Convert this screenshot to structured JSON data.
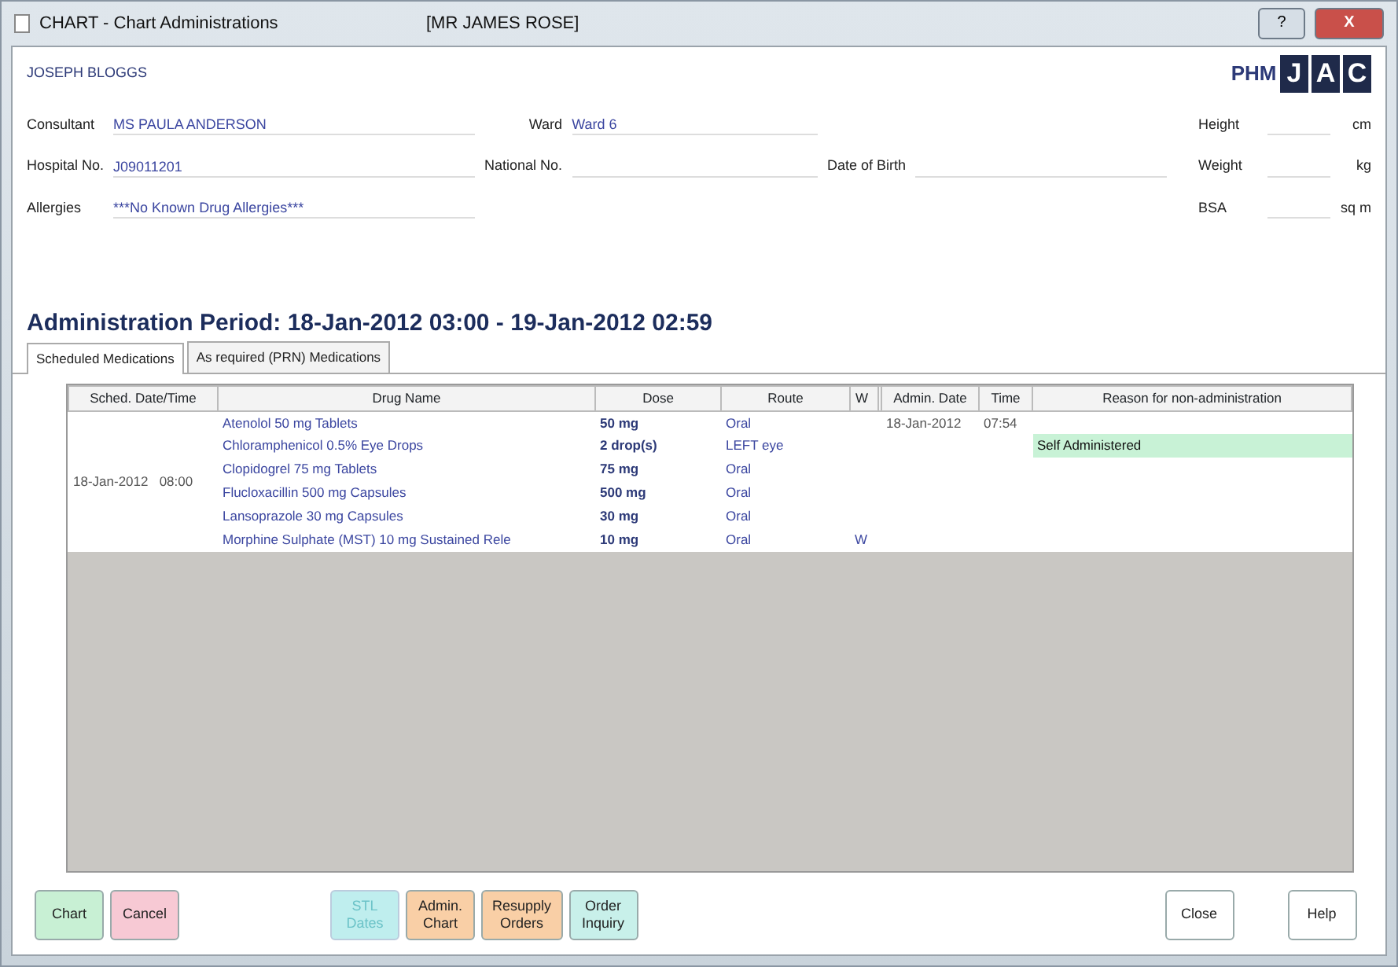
{
  "window": {
    "title": "CHART - Chart Administrations",
    "patient": "[MR JAMES ROSE]",
    "help_glyph": "?",
    "close_glyph": "X"
  },
  "header": {
    "name": "JOSEPH BLOGGS",
    "brand_prefix": "PHM",
    "brand_letters": [
      "J",
      "A",
      "C"
    ],
    "field_rows": [
      [
        {
          "label": "Consultant",
          "value": "MS PAULA ANDERSON"
        },
        {
          "label": "Ward",
          "value": "Ward 6"
        }
      ],
      [
        {
          "label": "Hospital No.",
          "value": "J09011201"
        },
        {
          "label": "National No."
        },
        {
          "label": "Date of Birth"
        }
      ],
      [
        {
          "label": "Allergies",
          "value": "***No Known Drug Allergies***"
        }
      ]
    ],
    "measures": [
      {
        "label": "Height",
        "unit": "cm"
      },
      {
        "label": "Weight",
        "unit": "kg"
      },
      {
        "label": "BSA",
        "unit": "sq m"
      }
    ]
  },
  "period": "Administration Period: 18-Jan-2012 03:00 - 19-Jan-2012 02:59",
  "tabs": [
    {
      "label": "Scheduled Medications",
      "selected": true
    },
    {
      "label": "As required (PRN) Medications",
      "selected": false
    }
  ],
  "table": {
    "columns": [
      "Sched. Date/Time",
      "Drug Name",
      "Dose",
      "Route",
      "W",
      "Admin. Date",
      "Time",
      "Reason for non-administration"
    ],
    "groups": [
      {
        "date": "18-Jan-2012",
        "time": "08:00",
        "rows": [
          {
            "drug": "Atenolol 50 mg Tablets",
            "dose": "50 mg",
            "route": "Oral",
            "w": "",
            "admin_date": "18-Jan-2012",
            "admin_time": "07:54",
            "reason": "",
            "highlighted": false
          },
          {
            "drug": "Chloramphenicol 0.5% Eye Drops",
            "dose": "2 drop(s)",
            "route": "LEFT eye",
            "w": "",
            "admin_date": "",
            "admin_time": "",
            "reason": "Self Administered",
            "highlighted": true
          },
          {
            "drug": "Clopidogrel 75 mg Tablets",
            "dose": "75 mg",
            "route": "Oral",
            "w": "",
            "admin_date": "",
            "admin_time": "",
            "reason": "",
            "highlighted": false
          },
          {
            "drug": "Flucloxacillin 500 mg Capsules",
            "dose": "500 mg",
            "route": "Oral",
            "w": "",
            "admin_date": "",
            "admin_time": "",
            "reason": "",
            "highlighted": false
          },
          {
            "drug": "Lansoprazole 30 mg Capsules",
            "dose": "30 mg",
            "route": "Oral",
            "w": "",
            "admin_date": "",
            "admin_time": "",
            "reason": "",
            "highlighted": false
          },
          {
            "drug": "Morphine Sulphate (MST) 10 mg Sustained Rele",
            "dose": "10 mg",
            "route": "Oral",
            "w": "W",
            "admin_date": "",
            "admin_time": "",
            "reason": "",
            "highlighted": false
          }
        ]
      }
    ]
  },
  "button_groups": [
    {
      "buttons": [
        {
          "lines": [
            "Chart"
          ],
          "color": "#c8f0d4",
          "disabled": false
        },
        {
          "lines": [
            "Cancel"
          ],
          "color": "#f7c9d4",
          "disabled": false
        }
      ]
    },
    {
      "buttons": [
        {
          "lines": [
            "STL",
            "Dates"
          ],
          "color": "#bfeeee",
          "disabled": true
        },
        {
          "lines": [
            "Admin.",
            "Chart"
          ],
          "color": "#f9cfa6",
          "disabled": false
        },
        {
          "lines": [
            "Resupply",
            "Orders"
          ],
          "color": "#f9cfa6",
          "disabled": false
        },
        {
          "lines": [
            "Order",
            "Inquiry"
          ],
          "color": "#c8f0ea",
          "disabled": false
        }
      ]
    },
    {
      "buttons": [
        {
          "lines": [
            "Close"
          ],
          "color": "#ffffff",
          "disabled": false
        },
        {
          "lines": [
            "Help"
          ],
          "color": "#ffffff",
          "disabled": false
        }
      ]
    }
  ]
}
